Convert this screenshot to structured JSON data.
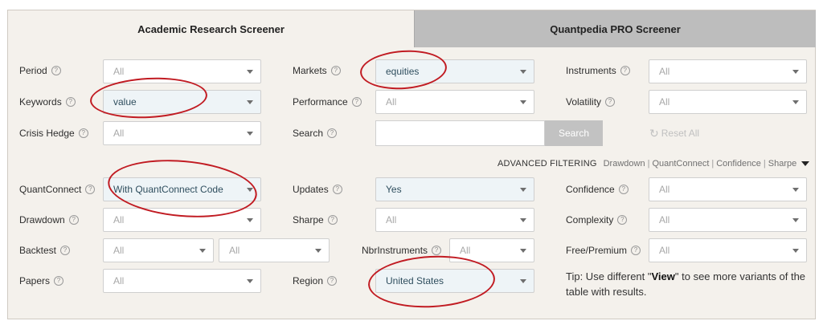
{
  "tabs": {
    "academic": "Academic Research Screener",
    "pro": "Quantpedia PRO Screener"
  },
  "filters": {
    "period": {
      "label": "Period",
      "value": "All"
    },
    "keywords": {
      "label": "Keywords",
      "value": "value"
    },
    "crisis_hedge": {
      "label": "Crisis Hedge",
      "value": "All"
    },
    "markets": {
      "label": "Markets",
      "value": "equities"
    },
    "performance": {
      "label": "Performance",
      "value": "All"
    },
    "search": {
      "label": "Search",
      "value": "",
      "button": "Search"
    },
    "instruments": {
      "label": "Instruments",
      "value": "All"
    },
    "volatility": {
      "label": "Volatility",
      "value": "All"
    },
    "reset_label": "Reset All"
  },
  "advanced": {
    "title": "ADVANCED FILTERING",
    "links": [
      "Drawdown",
      "QuantConnect",
      "Confidence",
      "Sharpe"
    ]
  },
  "advanced_filters": {
    "quantconnect": {
      "label": "QuantConnect",
      "value": "With QuantConnect Code"
    },
    "drawdown": {
      "label": "Drawdown",
      "value": "All"
    },
    "backtest": {
      "label": "Backtest",
      "value1": "All",
      "value2": "All"
    },
    "papers": {
      "label": "Papers",
      "value": "All"
    },
    "updates": {
      "label": "Updates",
      "value": "Yes"
    },
    "sharpe": {
      "label": "Sharpe",
      "value": "All"
    },
    "nbr_instruments": {
      "label": "NbrInstruments",
      "value": "All"
    },
    "region": {
      "label": "Region",
      "value": "United States"
    },
    "confidence": {
      "label": "Confidence",
      "value": "All"
    },
    "complexity": {
      "label": "Complexity",
      "value": "All"
    },
    "free_premium": {
      "label": "Free/Premium",
      "value": "All"
    }
  },
  "tip": {
    "prefix": "Tip: Use different \"",
    "bold": "View",
    "suffix": "\" to see more variants of the table with results."
  },
  "icons": {
    "help": "?",
    "reset": "↻"
  },
  "colors": {
    "annotation_ring": "#c11b22",
    "selected_bg": "#eef4f7",
    "inactive_tab": "#bdbdbd"
  }
}
